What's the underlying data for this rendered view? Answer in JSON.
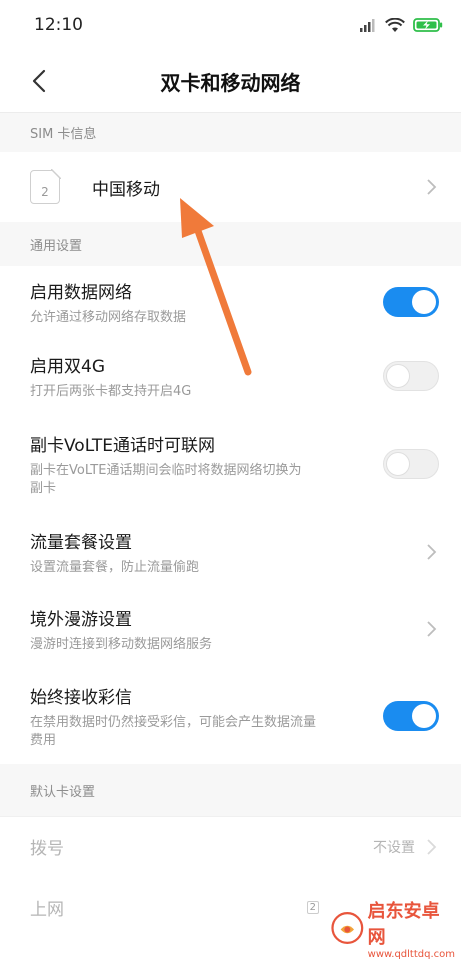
{
  "status_bar": {
    "time": "12:10"
  },
  "nav": {
    "title": "双卡和移动网络"
  },
  "sim_section": {
    "header": "SIM 卡信息",
    "sim_slot_number": "2",
    "carrier_name": "中国移动"
  },
  "general_section": {
    "header": "通用设置",
    "items": [
      {
        "title": "启用数据网络",
        "subtitle": "允许通过移动网络存取数据",
        "toggle": "on"
      },
      {
        "title": "启用双4G",
        "subtitle": "打开后两张卡都支持开启4G",
        "toggle": "off"
      },
      {
        "title": "副卡VoLTE通话时可联网",
        "subtitle_line1": "副卡在VoLTE通话期间会临时将数据网络切换为",
        "subtitle_line2": "副卡",
        "toggle": "off"
      },
      {
        "title": "流量套餐设置",
        "subtitle": "设置流量套餐，防止流量偷跑"
      },
      {
        "title": "境外漫游设置",
        "subtitle": "漫游时连接到移动数据网络服务"
      },
      {
        "title": "始终接收彩信",
        "subtitle_line1": "在禁用数据时仍然接受彩信，可能会产生数据流量",
        "subtitle_line2": "费用",
        "toggle": "on"
      }
    ]
  },
  "default_section": {
    "header": "默认卡设置",
    "dial": {
      "title": "拨号",
      "value": "不设置"
    },
    "internet": {
      "title": "上网",
      "sim_number": "2"
    }
  },
  "watermark": {
    "title": "启东安卓网",
    "url": "www.qdlttdq.com"
  },
  "colors": {
    "accent": "#1a8cf0",
    "arrow": "#f07a3a"
  }
}
